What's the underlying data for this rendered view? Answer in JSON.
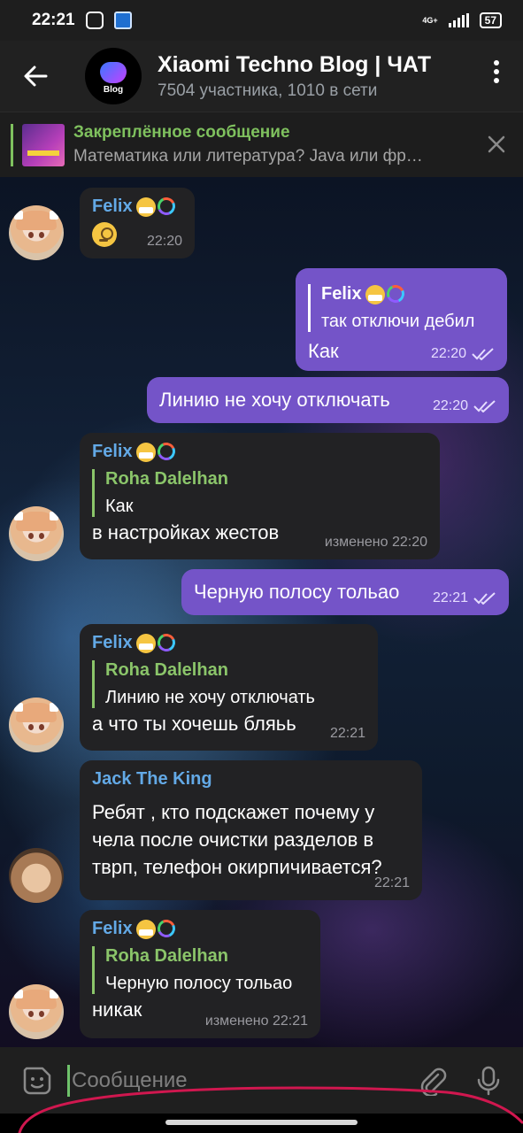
{
  "status_bar": {
    "time": "22:21",
    "network": "4G+",
    "battery": "57"
  },
  "header": {
    "title": "Xiaomi Techno Blog | ЧАТ",
    "subtitle": "7504 участника, 1010 в сети",
    "avatar_label": "Blog"
  },
  "pinned": {
    "title": "Закреплённое сообщение",
    "text": "Математика или литература? Java или фр…"
  },
  "messages": [
    {
      "sender": "Felix",
      "time": "22:20"
    },
    {
      "reply_name": "Felix",
      "reply_text": "так отключи дебил",
      "text": "Как",
      "time": "22:20"
    },
    {
      "text": "Линию не хочу отключать",
      "time": "22:20"
    },
    {
      "sender": "Felix",
      "reply_name": "Roha Dalelhan",
      "reply_text": "Как",
      "text": "в настройках жестов",
      "time": "изменено 22:20"
    },
    {
      "text": "Черную полосу тольао",
      "time": "22:21"
    },
    {
      "sender": "Felix",
      "reply_name": "Roha Dalelhan",
      "reply_text": "Линию не хочу отключать",
      "text": "а что ты хочешь бляьь",
      "time": "22:21"
    },
    {
      "sender": "Jack The King",
      "text_lines": [
        "Ребят , кто подскажет почему у",
        "чела после очистки разделов в",
        "тврп, телефон окирпичивается?"
      ],
      "time": "22:21"
    },
    {
      "sender": "Felix",
      "reply_name": "Roha Dalelhan",
      "reply_text": "Черную полосу тольао",
      "text": "никак",
      "time": "изменено 22:21"
    }
  ],
  "composer": {
    "placeholder": "Сообщение"
  },
  "colors": {
    "outgoing_bubble": "#7454c8",
    "incoming_bubble": "#222224",
    "sender_name": "#63a9e6",
    "reply_accent": "#8bc56a",
    "annotation": "#d0174f"
  },
  "icons": [
    "back-arrow-icon",
    "more-vertical-icon",
    "close-icon",
    "sticker-icon",
    "attach-icon",
    "mic-icon",
    "double-check-icon"
  ]
}
